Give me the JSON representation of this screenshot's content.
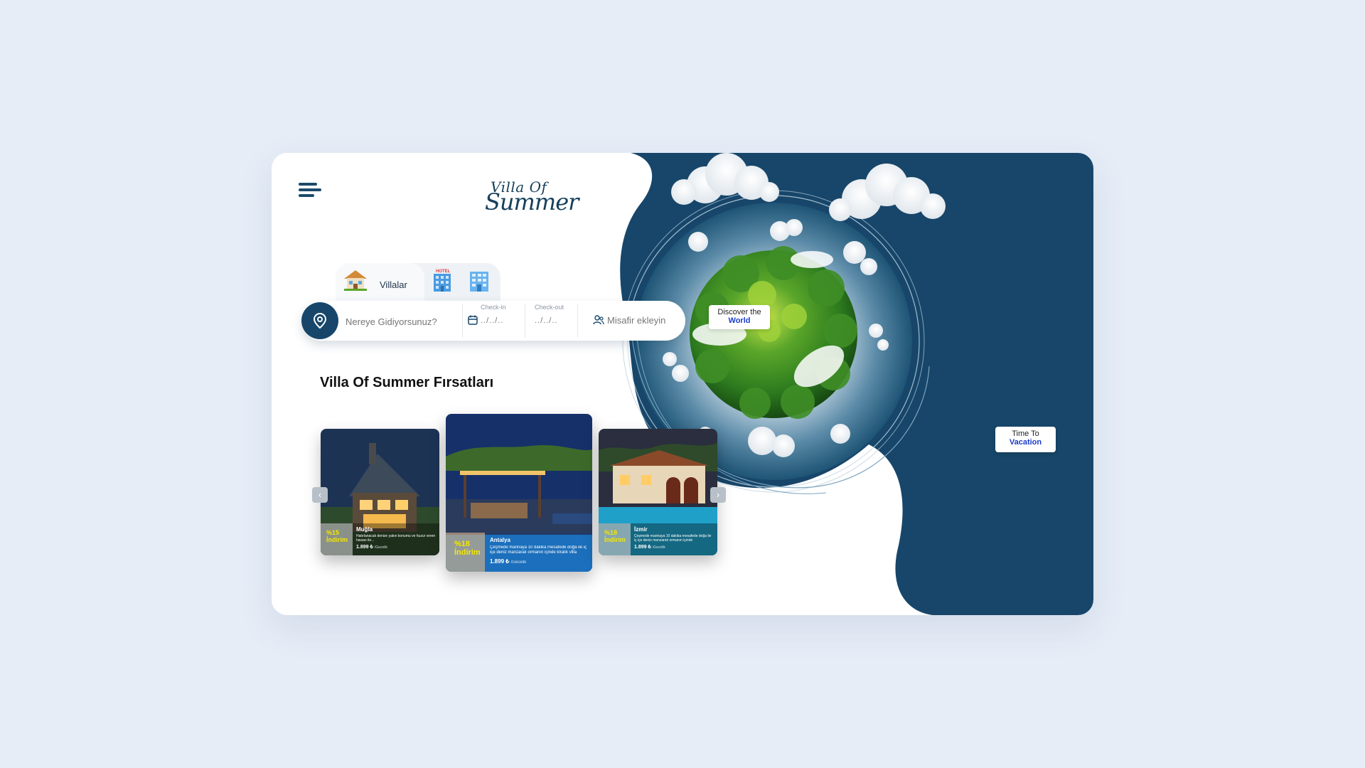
{
  "brand": {
    "line1": "Villa Of",
    "line2": "Summer"
  },
  "tabs": [
    {
      "label": "Villalar",
      "icon": "villa-house-icon"
    },
    {
      "label": "HOTEL",
      "icon": "hotel-building-icon"
    },
    {
      "label": "",
      "icon": "apartment-building-icon"
    }
  ],
  "search": {
    "destination_placeholder": "Nereye Gidiyorsunuz?",
    "checkin_label": "Check-in",
    "checkin_value": "../../..",
    "checkout_label": "Check-out",
    "checkout_value": "../../..",
    "guests_placeholder": "Misafir ekleyin"
  },
  "section_title": "Villa Of Summer Fırsatları",
  "villas": [
    {
      "city": "Muğla",
      "discount": "%15",
      "discount_word": "İndirim",
      "description": "Hatırlanacak denize yakın konumu ve huzur veren havası ile...",
      "price": "1.899 ₺",
      "unit": "/Gecelik"
    },
    {
      "city": "Antalya",
      "discount": "%18",
      "discount_word": "İndirim",
      "description": "Çeşmede marinaya 10 dakika mesafede doğa ile iç içe deniz manzaralı ormanın içinde kiralık villa",
      "price": "1.899 ₺",
      "unit": "/Gecelik"
    },
    {
      "city": "İzmir",
      "discount": "%18",
      "discount_word": "İndirim",
      "description": "Çeşmede marinaya 10 dakika mesafede doğa ile iç içe deniz manzaralı ormanın içinde",
      "price": "1.899 ₺",
      "unit": "/Gecelik"
    }
  ],
  "callouts": [
    {
      "line1": "Discover the",
      "line2": "World"
    },
    {
      "line1": "Time To",
      "line2": "Vacation"
    }
  ],
  "colors": {
    "navy": "#17466a",
    "background": "#e6edf7",
    "accent_blue": "#1b3bc9",
    "discount_yellow": "#f5e800"
  }
}
